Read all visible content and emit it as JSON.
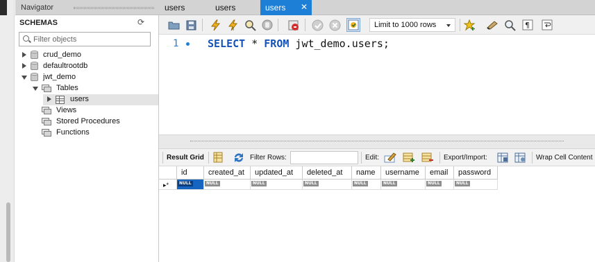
{
  "navigator": {
    "header_title": "Navigator",
    "schemas_title": "SCHEMAS",
    "filter_placeholder": "Filter objects",
    "schemas": [
      {
        "name": "crud_demo",
        "expanded": false
      },
      {
        "name": "defaultrootdb",
        "expanded": false
      },
      {
        "name": "jwt_demo",
        "expanded": true
      }
    ],
    "jwt_demo_children": {
      "tables_label": "Tables",
      "table_items": [
        "users"
      ],
      "views_label": "Views",
      "procedures_label": "Stored Procedures",
      "functions_label": "Functions"
    }
  },
  "tabs": [
    {
      "label": "users",
      "active": false
    },
    {
      "label": "users",
      "active": false
    },
    {
      "label": "users",
      "active": true
    }
  ],
  "toolbar": {
    "limit_select_value": "Limit to 1000 rows",
    "icons": [
      "open-folder-icon",
      "save-icon",
      "execute-icon",
      "execute-current-icon",
      "explain-icon",
      "stop-icon",
      "toggle-error-icon",
      "commit-icon",
      "rollback-icon",
      "autocommit-icon",
      "bookmark-icon",
      "beautify-icon",
      "find-icon",
      "invisibles-icon",
      "wrap-icon"
    ]
  },
  "editor": {
    "line_number": "1",
    "sql_keyword_1": "SELECT",
    "sql_star": " * ",
    "sql_keyword_2": "FROM",
    "sql_rest": " jwt_demo.users;"
  },
  "result_toolbar": {
    "result_grid_label": "Result Grid",
    "filter_rows_label": "Filter Rows:",
    "edit_label": "Edit:",
    "export_label": "Export/Import:",
    "wrap_label": "Wrap Cell Content"
  },
  "grid": {
    "columns": [
      "id",
      "created_at",
      "updated_at",
      "deleted_at",
      "name",
      "username",
      "email",
      "password"
    ],
    "new_row_marker": "▸*",
    "null_text": "NULL"
  },
  "colors": {
    "active_tab": "#1e7fd6",
    "keyword": "#1653b8",
    "selected_cell": "#1565c0"
  }
}
